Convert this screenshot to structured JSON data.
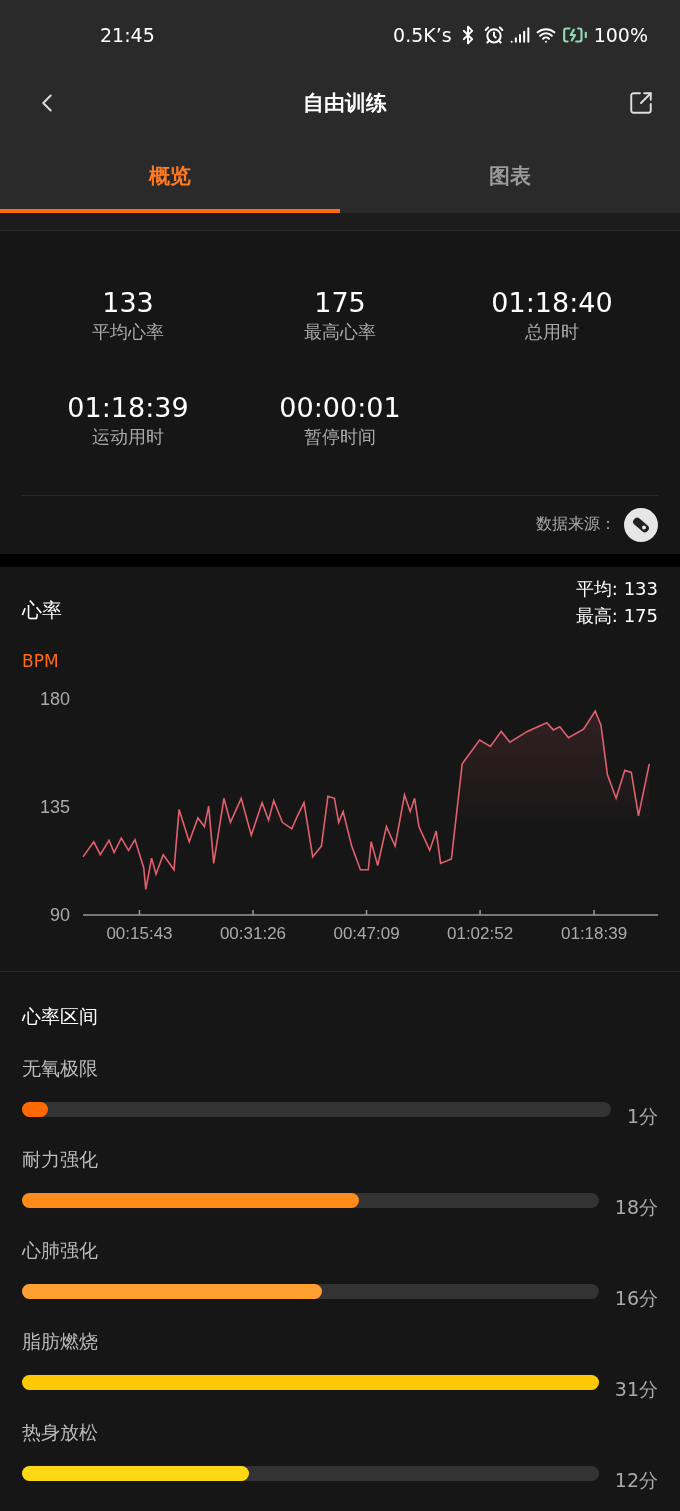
{
  "status_bar": {
    "time": "21:45",
    "network_speed": "0.5K’s",
    "battery": "100%"
  },
  "header": {
    "title": "自由训练"
  },
  "tabs": [
    {
      "label": "概览",
      "selected": true
    },
    {
      "label": "图表",
      "selected": false
    }
  ],
  "stats": [
    {
      "value": "133",
      "label": "平均心率"
    },
    {
      "value": "175",
      "label": "最高心率"
    },
    {
      "value": "01:18:40",
      "label": "总用时"
    },
    {
      "value": "01:18:39",
      "label": "运动用时"
    },
    {
      "value": "00:00:01",
      "label": "暂停时间"
    }
  ],
  "data_source": {
    "label": "数据来源："
  },
  "heart_rate": {
    "title": "心率",
    "average": "平均: 133",
    "max": "最高: 175",
    "chart_data": {
      "type": "area",
      "ylabel": "BPM",
      "xlim": [
        7.9,
        87.5
      ],
      "ylim": [
        90,
        180
      ],
      "yticks": [
        90,
        135,
        180
      ],
      "xticks": [
        {
          "value": 15.72,
          "label": "00:15:43"
        },
        {
          "value": 31.43,
          "label": "00:31:26"
        },
        {
          "value": 47.15,
          "label": "00:47:09"
        },
        {
          "value": 62.87,
          "label": "01:02:52"
        },
        {
          "value": 78.65,
          "label": "01:18:39"
        }
      ],
      "x": [
        7.9,
        9.4,
        10.3,
        11.5,
        12.2,
        13.2,
        14.2,
        15.1,
        16.3,
        16.6,
        17.4,
        18.0,
        19.0,
        20.5,
        21.2,
        22.6,
        23.8,
        24.7,
        25.3,
        26.0,
        27.4,
        28.3,
        29.8,
        31.2,
        32.7,
        33.6,
        34.3,
        35.5,
        36.8,
        37.6,
        38.5,
        39.7,
        40.9,
        41.8,
        42.7,
        43.3,
        43.9,
        45.1,
        46.3,
        47.4,
        47.8,
        48.7,
        49.9,
        51.1,
        52.4,
        53.2,
        53.8,
        54.4,
        55.9,
        56.8,
        57.4,
        58.9,
        60.4,
        62.8,
        64.3,
        65.8,
        67.0,
        69.4,
        72.1,
        73.0,
        73.9,
        75.1,
        77.2,
        78.8,
        79.6,
        80.5,
        81.7,
        82.9,
        83.8,
        84.8,
        86.3
      ],
      "series": [
        {
          "color": "#e0606e",
          "values": [
            113.8,
            120.1,
            114.7,
            120.7,
            115.6,
            121.6,
            116.5,
            121,
            109.3,
            100.3,
            113.3,
            106.6,
            114.7,
            108.4,
            133.6,
            120.1,
            130,
            126.4,
            134.9,
            111.1,
            138.2,
            128.2,
            138.2,
            122.8,
            136.4,
            129.1,
            137.3,
            128.2,
            125.5,
            130.9,
            136.4,
            113.8,
            118.3,
            139.1,
            138.2,
            128.2,
            132.7,
            118.3,
            108.4,
            108.4,
            120.1,
            110.2,
            126.4,
            118.3,
            139.6,
            132.7,
            138.2,
            126.4,
            116.5,
            124.6,
            111.1,
            112.9,
            152.6,
            162.5,
            159.8,
            166.1,
            161.6,
            166.1,
            169.7,
            166.7,
            168,
            163.4,
            167,
            174.6,
            168.8,
            148.1,
            138.2,
            149.9,
            149,
            130.9,
            152.6
          ]
        }
      ]
    }
  },
  "zones": {
    "title": "心率区间",
    "items": [
      {
        "name": "无氧极限",
        "level": 0.044,
        "duration": "1分",
        "color": "#ff6a00"
      },
      {
        "name": "耐力强化",
        "level": 0.585,
        "duration": "18分",
        "color": "#ff8c1a"
      },
      {
        "name": "心肺强化",
        "level": 0.52,
        "duration": "16分",
        "color": "#ffa030"
      },
      {
        "name": "脂肪燃烧",
        "level": 1.0,
        "duration": "31分",
        "color": "#ffc800"
      },
      {
        "name": "热身放松",
        "level": 0.394,
        "duration": "12分",
        "color": "#ffd814"
      }
    ]
  }
}
